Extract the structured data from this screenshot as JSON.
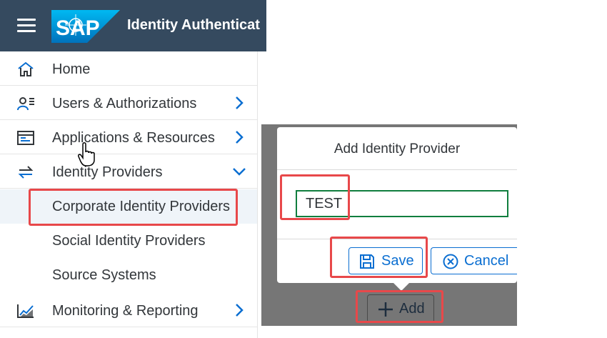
{
  "header": {
    "logo_text": "SAP",
    "title": "Identity Authenticat"
  },
  "nav": {
    "items": [
      {
        "label": "Home",
        "icon": "home-icon"
      },
      {
        "label": "Users & Authorizations",
        "icon": "users-icon"
      },
      {
        "label": "Applications & Resources",
        "icon": "applications-icon"
      },
      {
        "label": "Identity Providers",
        "icon": "identity-providers-icon",
        "expanded": true
      },
      {
        "label": "Monitoring & Reporting",
        "icon": "monitoring-icon"
      }
    ],
    "subitems": [
      {
        "label": "Corporate Identity Providers",
        "selected": true
      },
      {
        "label": "Social Identity Providers"
      },
      {
        "label": "Source Systems"
      }
    ]
  },
  "dialog": {
    "title": "Add Identity Provider",
    "input_value": "TEST",
    "save_label": "Save",
    "cancel_label": "Cancel"
  },
  "toolbar": {
    "add_label": "Add"
  },
  "colors": {
    "shell": "#354a5f",
    "accent": "#0a6ed1",
    "input_border": "#107e3e",
    "annotation": "#e8484a",
    "selected_bg": "#eff4f9"
  }
}
